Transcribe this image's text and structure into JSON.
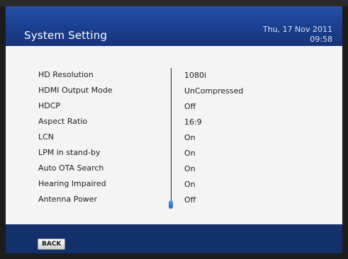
{
  "header": {
    "title": "System Setting",
    "date": "Thu, 17 Nov 2011",
    "time": "09:58"
  },
  "settings": [
    {
      "label": "HD Resolution",
      "value": "1080i"
    },
    {
      "label": "HDMI Output Mode",
      "value": "UnCompressed"
    },
    {
      "label": "HDCP",
      "value": "Off"
    },
    {
      "label": "Aspect Ratio",
      "value": "16:9"
    },
    {
      "label": "LCN",
      "value": "On"
    },
    {
      "label": "LPM in stand-by",
      "value": "On"
    },
    {
      "label": "Auto OTA Search",
      "value": "On"
    },
    {
      "label": "Hearing Impaired",
      "value": "On"
    },
    {
      "label": "Antenna Power",
      "value": "Off"
    }
  ],
  "footer": {
    "back_label": "BACK"
  },
  "colors": {
    "header_blue": "#1a3d8c",
    "content_bg": "#f4f4f4",
    "frame_bg": "#12306a",
    "scroll_accent": "#1d5ec8"
  }
}
